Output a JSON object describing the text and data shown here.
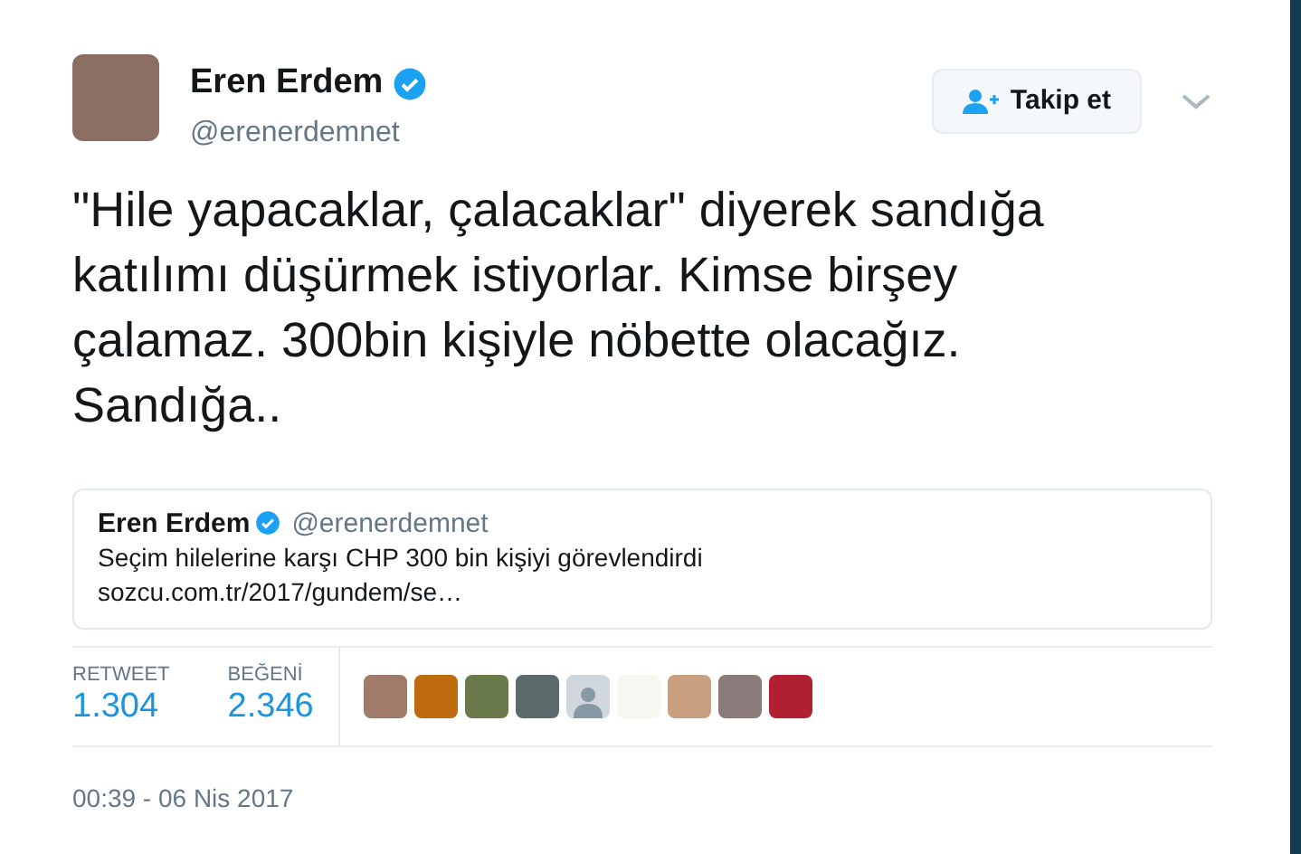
{
  "author": {
    "name": "Eren Erdem",
    "verified": true,
    "handle": "@erenerdemnet"
  },
  "follow_button": {
    "label": "Takip et"
  },
  "tweet_text": "\"Hile yapacaklar, çalacaklar\" diyerek sandığa katılımı düşürmek istiyorlar. Kimse birşey çalamaz. 300bin kişiyle nöbette olacağız. Sandığa..",
  "quoted_tweet": {
    "name": "Eren Erdem",
    "verified": true,
    "handle": "@erenerdemnet",
    "text": "Seçim hilelerine karşı CHP 300 bin kişiyi görevlendirdi",
    "link": "sozcu.com.tr/2017/gundem/se…"
  },
  "stats": [
    {
      "label": "RETWEET",
      "value": "1.304"
    },
    {
      "label": "BEĞENİ",
      "value": "2.346"
    }
  ],
  "likers": [
    {
      "kind": "photo",
      "color": "#a07a6a"
    },
    {
      "kind": "photo",
      "color": "#c06a10"
    },
    {
      "kind": "photo",
      "color": "#6a7a4a"
    },
    {
      "kind": "photo",
      "color": "#5a6a6a"
    },
    {
      "kind": "default",
      "color": "#cfd6dc"
    },
    {
      "kind": "photo",
      "color": "#f4f8f0"
    },
    {
      "kind": "photo",
      "color": "#c8a080"
    },
    {
      "kind": "photo",
      "color": "#8a7a7a"
    },
    {
      "kind": "photo",
      "color": "#b02030"
    }
  ],
  "timestamp": "00:39 - 06 Nis 2017"
}
